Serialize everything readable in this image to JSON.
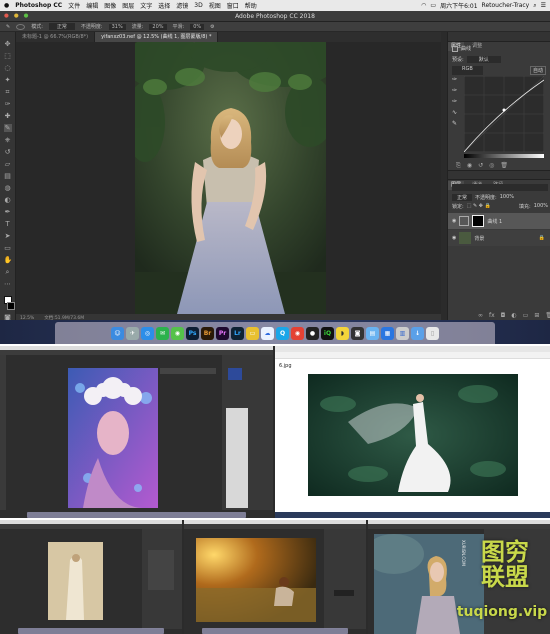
{
  "mac_menu": {
    "app": "Photoshop CC",
    "items": [
      "文件",
      "编辑",
      "图像",
      "图层",
      "文字",
      "选择",
      "滤镜",
      "3D",
      "视图",
      "窗口",
      "帮助"
    ],
    "clock": "周六下午6:01",
    "user": "Retoucher-Tracy"
  },
  "window_title": "Adobe Photoshop CC 2018",
  "options": {
    "mode_label": "模式:",
    "mode_value": "正常",
    "opacity_label": "不透明度:",
    "opacity_value": "31%",
    "flow_label": "流量:",
    "flow_value": "20%",
    "smooth_label": "平滑:",
    "smooth_value": "0%"
  },
  "tabs": [
    {
      "label": "未标题-1 @ 66.7%(RGB/8*)",
      "active": false
    },
    {
      "label": "yifanxz03.nef @ 12.5% (曲线 1, 图层蒙版/8) *",
      "active": true
    }
  ],
  "status": {
    "zoom": "12.5%",
    "doc": "文档:51.9M/73.6M"
  },
  "panels": {
    "top_tabs": [
      "属性",
      "调整"
    ],
    "curves_title": "曲线",
    "preset_label": "预设:",
    "preset_value": "默认",
    "channel_value": "RGB",
    "auto_label": "自动",
    "layer_tabs": [
      "图层",
      "通道",
      "路径"
    ],
    "blend_value": "正常",
    "opacity_label": "不透明度:",
    "opacity_value": "100%",
    "lock_label": "锁定:",
    "fill_label": "填充:",
    "fill_value": "100%",
    "layers": [
      "曲线 1",
      "背景"
    ]
  },
  "thumb2": {
    "filename": "6.jpg"
  },
  "watermark": {
    "line1": "图穷",
    "line2": "联盟",
    "url": "tuqiong.vip",
    "side": "XURISN.COM"
  },
  "colors": {
    "ps_bg": "#282828",
    "panel": "#3a3a3a",
    "accent_blue": "#4a88d8",
    "watermark_green": "#c8d84a"
  }
}
